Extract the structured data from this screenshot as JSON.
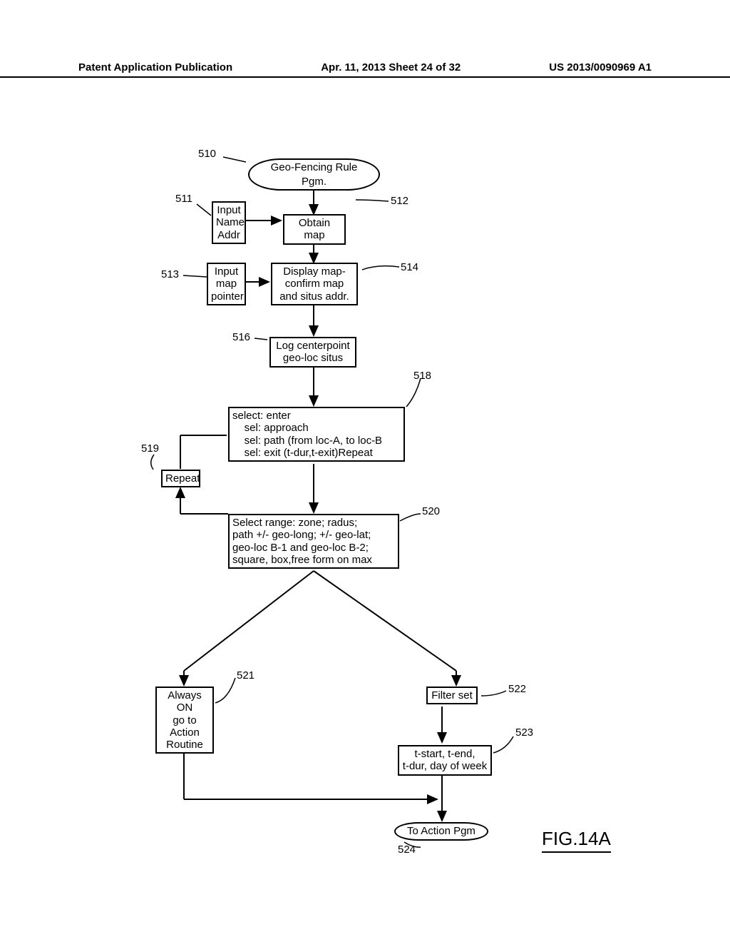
{
  "header": {
    "left": "Patent Application Publication",
    "center": "Apr. 11, 2013  Sheet 24 of 32",
    "right": "US 2013/0090969 A1"
  },
  "labels": {
    "n510": "510",
    "n511": "511",
    "n512": "512",
    "n513": "513",
    "n514": "514",
    "n516": "516",
    "n518": "518",
    "n519": "519",
    "n520": "520",
    "n521": "521",
    "n522": "522",
    "n523": "523",
    "n524": "524"
  },
  "boxes": {
    "b510": "Geo-Fencing Rule Pgm.",
    "b511": "Input\nName\nAddr",
    "b512": "Obtain map",
    "b513": "Input\nmap\npointer",
    "b514": "Display map-\nconfirm map\nand situs addr.",
    "b516": "Log centerpoint\ngeo-loc situs",
    "b518": "select: enter\n    sel: approach\n    sel: path (from loc-A, to loc-B\n    sel: exit (t-dur,t-exit)Repeat",
    "b519": "Repeat",
    "b520": "Select range: zone; radus;\npath +/- geo-long; +/- geo-lat;\ngeo-loc B-1 and geo-loc B-2;\nsquare, box,free form on max",
    "b521": "Always ON\ngo to\nAction\nRoutine",
    "b522": "Filter set",
    "b523": "t-start, t-end,\nt-dur, day of week",
    "b524": "To Action Pgm"
  },
  "figure": "FIG.14A"
}
